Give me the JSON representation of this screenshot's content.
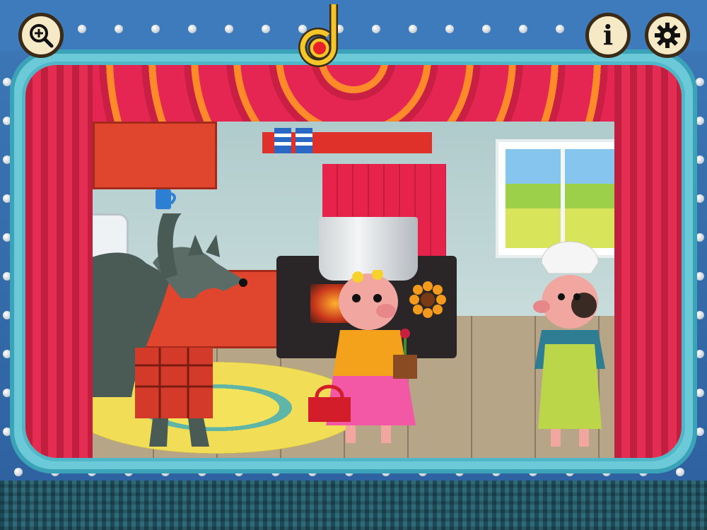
{
  "toolbar": {
    "zoom_icon": "zoom-in-icon",
    "record_icon": "music-note-record-icon",
    "info_icon": "info-icon",
    "info_glyph": "i",
    "settings_icon": "gear-icon"
  },
  "scene": {
    "characters": [
      "wolf",
      "pig-with-flower",
      "pig-chef"
    ],
    "props": [
      "pot",
      "stove",
      "window",
      "rug",
      "curtains",
      "cabinets",
      "mug",
      "flower-pot",
      "handbag",
      "sunflower"
    ]
  },
  "colors": {
    "frame_blue": "#3e7bbd",
    "stage_teal": "#6cc9d8",
    "curtain_red": "#e32d52",
    "button_cream": "#f6e9c5",
    "note_yellow": "#f4c62a",
    "record_red": "#e8202a"
  }
}
